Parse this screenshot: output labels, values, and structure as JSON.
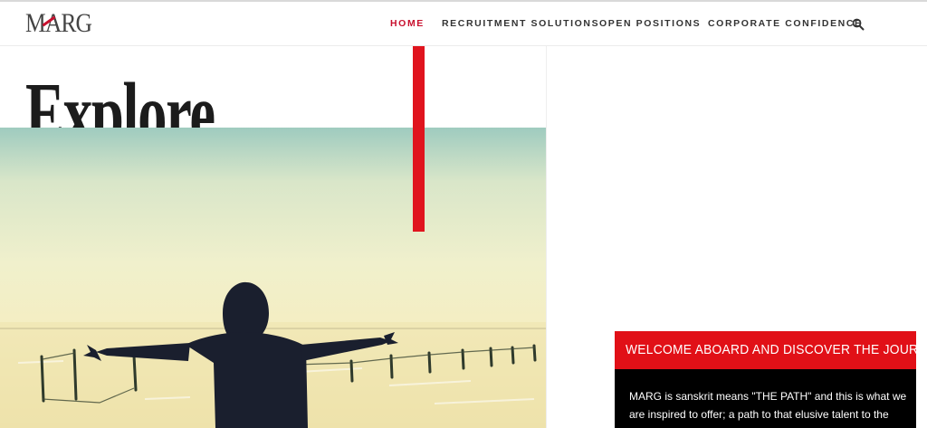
{
  "header": {
    "logo_text": "MARG",
    "nav": [
      {
        "label": "HOME",
        "active": true
      },
      {
        "label": "RECRUITMENT SOLUTIONS",
        "active": false
      },
      {
        "label": "OPEN POSITIONS",
        "active": false
      },
      {
        "label": "CORPORATE CONFIDENCE",
        "active": false
      }
    ],
    "search_icon": "search-icon"
  },
  "hero": {
    "headline": "Explore...",
    "image": "silhouette-hooded-figure-arms-outstretched-snowy-field"
  },
  "welcome": {
    "title": "WELCOME ABOARD AND DISCOVER THE JOURNEY",
    "lines": [
      "MARG is sanskrit means \"THE PATH\" and this is what we",
      "are inspired to offer; a path to that elusive talent to the"
    ]
  },
  "colors": {
    "accent": "#e11017",
    "nav_active": "#c8102e",
    "text_dark": "#1c1c1c",
    "welcome_bg": "#000000"
  }
}
